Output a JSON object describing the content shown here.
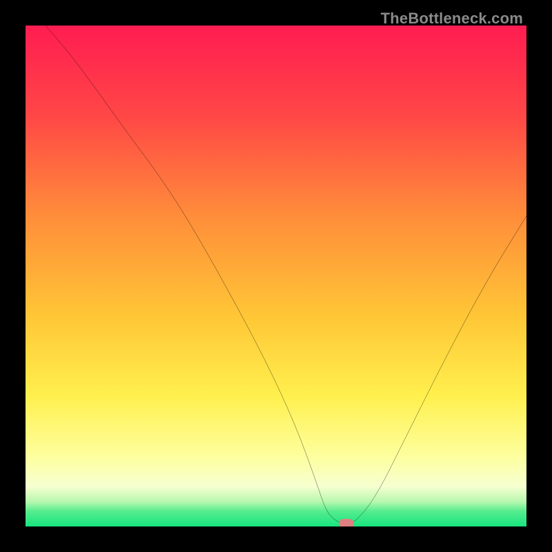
{
  "watermark": "TheBottleneck.com",
  "chart_data": {
    "type": "line",
    "title": "",
    "xlabel": "",
    "ylabel": "",
    "xlim": [
      0,
      100
    ],
    "ylim": [
      0,
      100
    ],
    "grid": false,
    "legend": false,
    "x": [
      4,
      10,
      20,
      26,
      32,
      40,
      48,
      54,
      58,
      60,
      62,
      64,
      66,
      70,
      76,
      84,
      92,
      100
    ],
    "y": [
      100,
      93,
      79,
      71,
      62,
      48,
      33,
      20,
      9,
      3,
      1,
      0.5,
      1,
      6,
      18,
      34,
      49,
      62
    ],
    "marker": {
      "x": 64,
      "y": 0.5
    }
  },
  "colors": {
    "top": "#ff1c51",
    "mid1": "#ff7e3a",
    "mid2": "#ffd035",
    "mid3": "#fff24f",
    "pale": "#fdffb0",
    "green": "#17e57e",
    "curve": "#000000",
    "marker": "#de8082",
    "frame": "#000000",
    "wm": "#8a8a8a"
  }
}
